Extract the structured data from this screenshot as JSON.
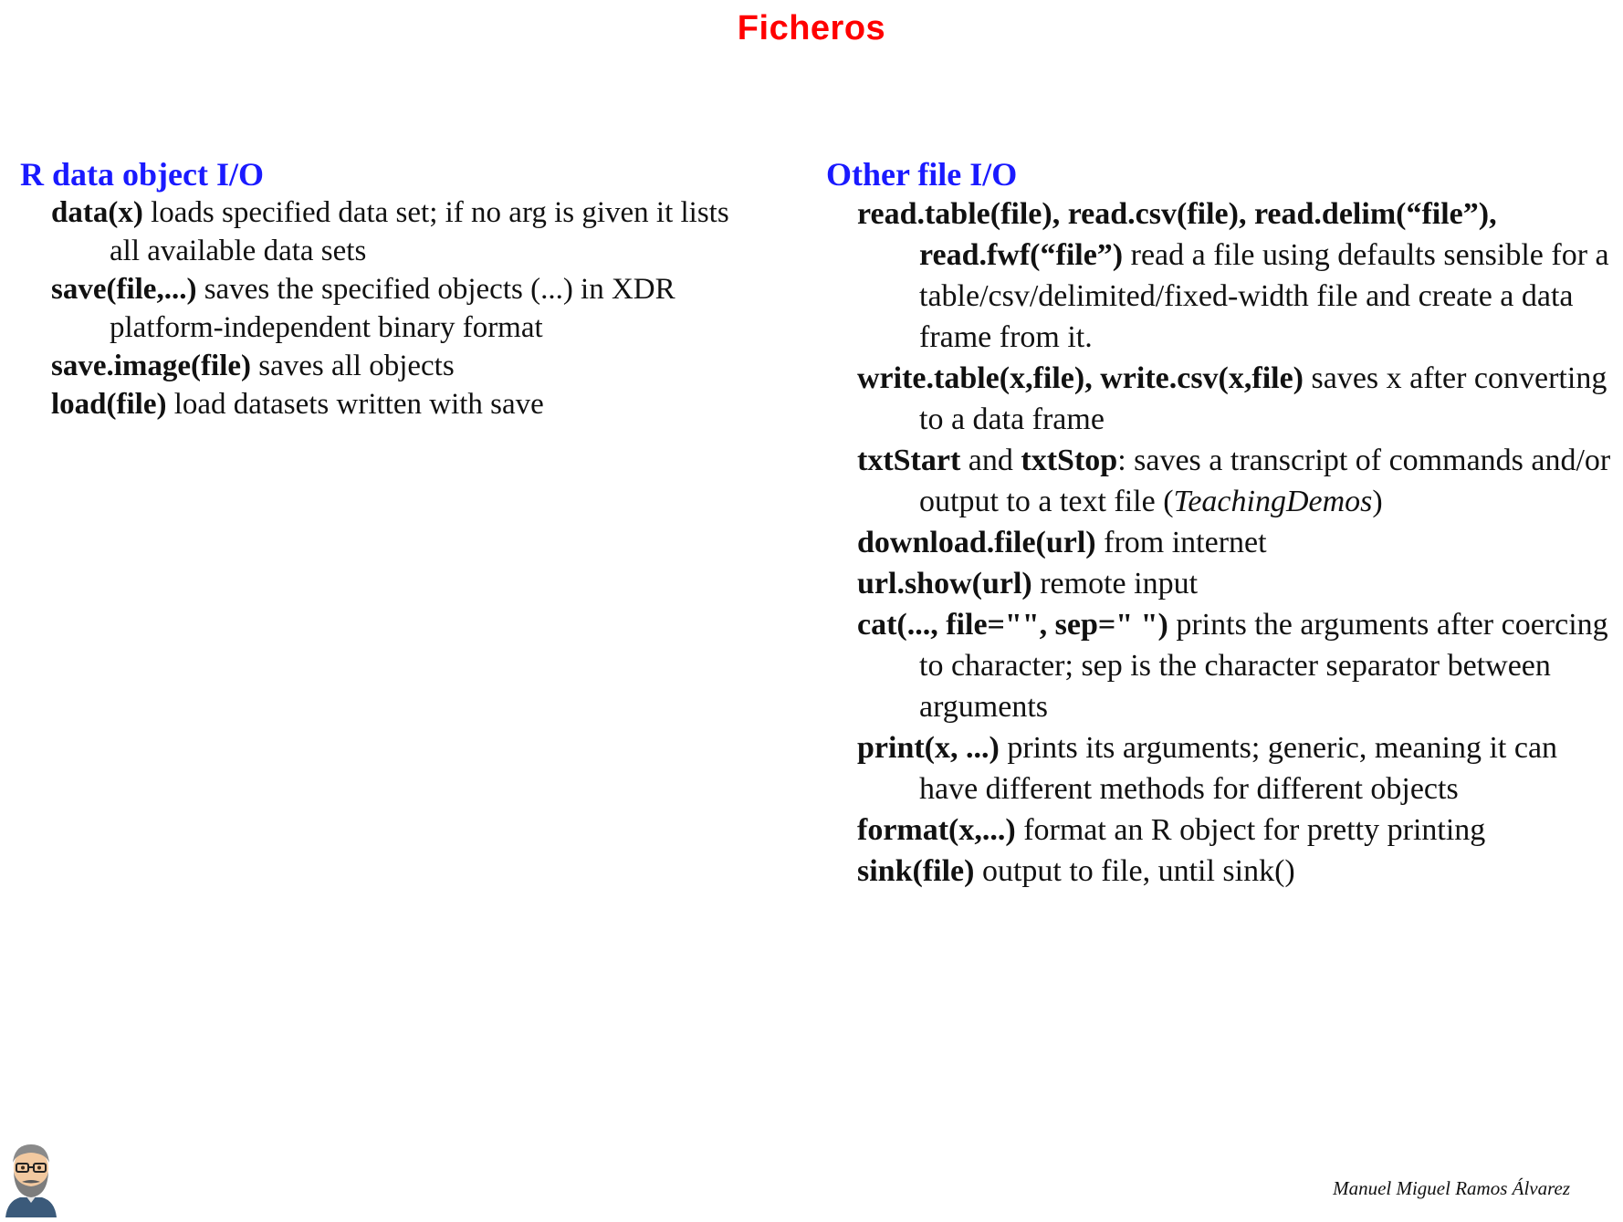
{
  "title": "Ficheros",
  "left": {
    "heading": "R data object I/O",
    "items": [
      {
        "fn": "data(x)",
        "desc": " loads specified data set; if no arg is given it lists all available data sets"
      },
      {
        "fn": "save(file,...)",
        "desc": " saves the specified objects (...) in XDR platform-independent binary format"
      },
      {
        "fn": "save.image(file)",
        "desc": " saves all objects"
      },
      {
        "fn": "load(file)",
        "desc": " load datasets written with save"
      }
    ]
  },
  "right": {
    "heading": "Other file I/O",
    "items": [
      {
        "fn": "read.table(file), read.csv(file), read.delim(“file”), read.fwf(“file”)",
        "desc": " read a file using defaults sensible for a table/csv/delimited/fixed-width file and create a data frame from it."
      },
      {
        "fn": "write.table(x,file), write.csv(x,file)",
        "desc": " saves x after converting to a data frame"
      },
      {
        "fn1": "txtStart",
        "mid": " and ",
        "fn2": "txtStop",
        "desc_a": ": saves a transcript of commands and/or output to a text file (",
        "desc_it": "TeachingDemos",
        "desc_b": ")"
      },
      {
        "fn": "download.file(url)",
        "desc": " from internet"
      },
      {
        "fn": "url.show(url)",
        "desc": " remote input"
      },
      {
        "fn": "cat(..., file=\"\", sep=\" \")",
        "desc": " prints the arguments after coercing to character; sep is the character separator between arguments"
      },
      {
        "fn": "print(x, ...)",
        "desc": " prints its arguments; generic, meaning it can have different methods for different objects"
      },
      {
        "fn": "format(x,...)",
        "desc": " format an R object for pretty printing"
      },
      {
        "fn": "sink(file)",
        "desc": " output to file, until sink()"
      }
    ]
  },
  "footer": {
    "signature": "Manuel Miguel Ramos Álvarez",
    "avatar_icon": "bearded-man-avatar-icon"
  }
}
